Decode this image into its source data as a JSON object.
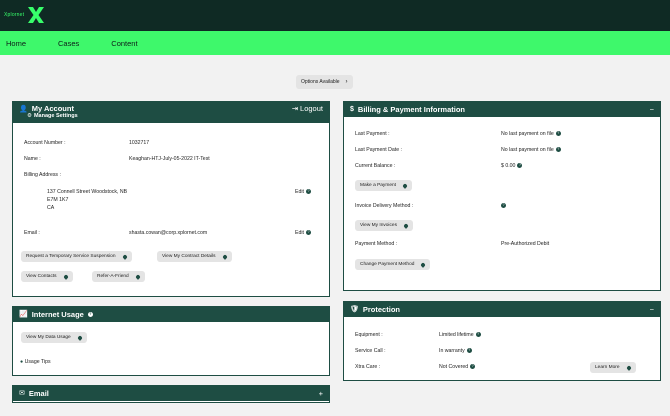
{
  "brand": {
    "small": "Xplornet",
    "icon": "x-logo-icon"
  },
  "nav": {
    "items": [
      "Home",
      "Cases",
      "Content"
    ]
  },
  "options": {
    "label": "Options Available"
  },
  "account": {
    "title": "My Account",
    "manage_settings": "Manage Settings",
    "logout": "Logout",
    "account_number_label": "Account Number :",
    "account_number": "1032717",
    "name_label": "Name :",
    "name": "Keaghan-HTJ-July-05-2022 IT-Test",
    "billing_address_label": "Billing Address :",
    "address_line1": "137 Connell Street Woodstock, NB",
    "address_line2": "E7M 1K7",
    "address_line3": "CA",
    "edit": "Edit",
    "email_label": "Email :",
    "email": "shasta.cowan@corp.xplornet.com",
    "buttons": {
      "suspension": "Request a Temporary Service Suspension",
      "contract": "View My Contract Details",
      "contacts": "View Contacts",
      "refer": "Refer-A-Friend"
    }
  },
  "internet": {
    "title": "Internet Usage",
    "view_usage": "View My Data Usage",
    "usage_tips": "Usage Tips"
  },
  "email_panel": {
    "title": "Email",
    "expand": "+"
  },
  "billing": {
    "title": "Billing & Payment Information",
    "collapse": "−",
    "last_payment_label": "Last Payment :",
    "last_payment": "No last payment on file",
    "last_payment_date_label": "Last Payment Date :",
    "last_payment_date": "No last payment on file",
    "current_balance_label": "Current Balance :",
    "current_balance": "$ 0.00",
    "make_payment": "Make a Payment",
    "invoice_method_label": "Invoice Delivery Method :",
    "view_invoices": "View My Invoices",
    "payment_method_label": "Payment Method :",
    "payment_method": "Pre-Authorized Debit",
    "change_payment": "Change Payment Method"
  },
  "protection": {
    "title": "Protection",
    "collapse": "−",
    "equipment_label": "Equipment :",
    "equipment": "Limited lifetime",
    "service_call_label": "Service Call :",
    "service_call": "In warranty",
    "xtra_care_label": "Xtra Care :",
    "xtra_care": "Not Covered",
    "learn_more": "Learn More"
  },
  "colors": {
    "header": "#0f2a24",
    "nav": "#3ef86b",
    "panel": "#1e4d43"
  }
}
